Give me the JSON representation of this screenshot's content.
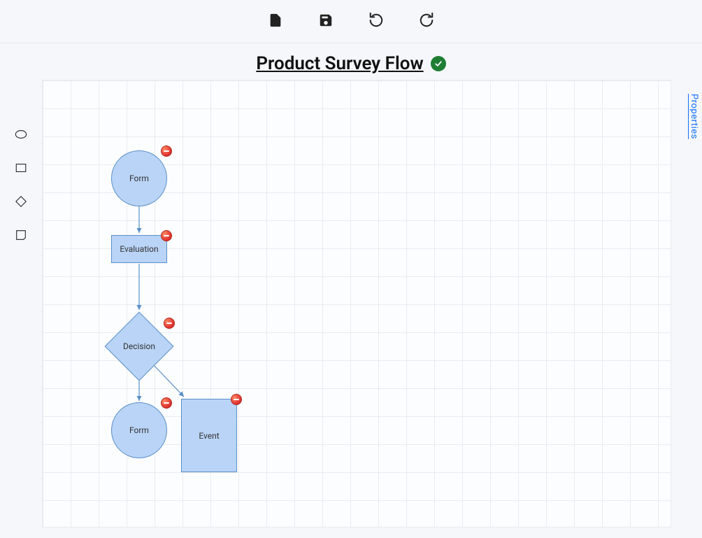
{
  "toolbar": {
    "new_icon": "file",
    "save_icon": "save",
    "undo_icon": "undo",
    "redo_icon": "redo"
  },
  "title": "Product Survey Flow",
  "status": "ok",
  "properties_tab": "Properties",
  "stencil": {
    "ellipse": "ellipse-shape",
    "rect": "rect-shape",
    "diamond": "diamond-shape",
    "event": "event-shape"
  },
  "nodes": {
    "n1": {
      "label": "Form"
    },
    "n2": {
      "label": "Evaluation"
    },
    "n3": {
      "label": "Decision"
    },
    "n4": {
      "label": "Form"
    },
    "n5": {
      "label": "Event"
    }
  }
}
